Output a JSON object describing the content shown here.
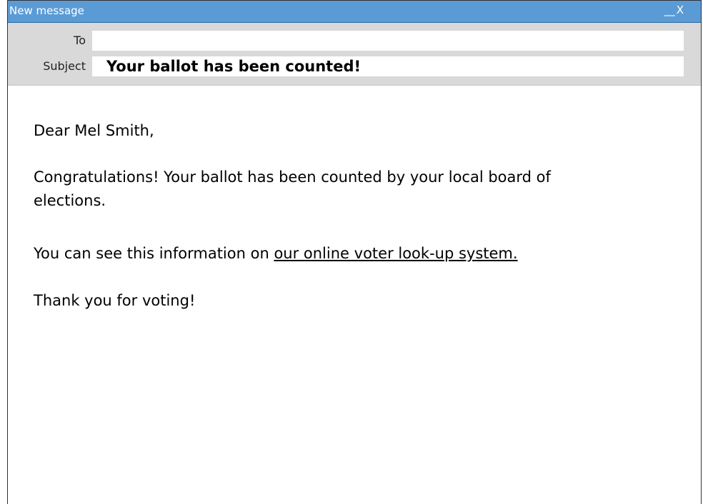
{
  "window": {
    "title": "New message",
    "minimize_label": "__",
    "close_label": "X"
  },
  "compose": {
    "to_label": "To",
    "to_value": "",
    "subject_label": "Subject",
    "subject_value": "Your ballot has been counted!"
  },
  "message": {
    "greeting": "Dear Mel Smith,",
    "congrats": "Congratulations! Your ballot has been counted by your local board of elections.",
    "info_prefix": "You can see this information on ",
    "info_link": "our online voter look-up system.",
    "thanks": "Thank you for voting!"
  }
}
